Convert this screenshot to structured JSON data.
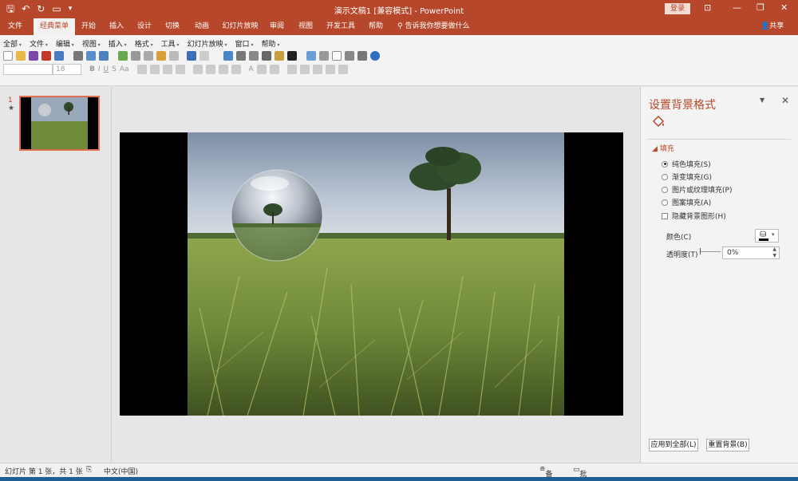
{
  "window": {
    "title": "演示文稿1 [兼容模式]  -  PowerPoint",
    "login_label": "登录"
  },
  "ribbon_tabs": [
    "文件",
    "经典菜单",
    "开始",
    "插入",
    "设计",
    "切换",
    "动画",
    "幻灯片放映",
    "审阅",
    "视图",
    "开发工具",
    "帮助"
  ],
  "active_tab": "经典菜单",
  "tell_me": "告诉我你想要做什么",
  "share": "共享",
  "classic_menu": [
    "全部",
    "文件",
    "编辑",
    "视图",
    "插入",
    "格式",
    "工具",
    "幻灯片放映",
    "窗口",
    "帮助"
  ],
  "font_size_value": "18",
  "slides": [
    {
      "number": "1",
      "marker": "★"
    }
  ],
  "format_pane": {
    "title": "设置背景格式",
    "section": "填充",
    "fill_options": [
      {
        "label": "纯色填充(S)",
        "selected": true
      },
      {
        "label": "渐变填充(G)",
        "selected": false
      },
      {
        "label": "图片或纹理填充(P)",
        "selected": false
      },
      {
        "label": "图案填充(A)",
        "selected": false
      }
    ],
    "hide_background": "隐藏背景图形(H)",
    "color_label": "颜色(C)",
    "transparency_label": "透明度(T)",
    "transparency_value": "0%",
    "apply_all": "应用到全部(L)",
    "reset_background": "重置背景(B)"
  },
  "statusbar": {
    "slide_info": "幻灯片 第 1 张，共 1 张",
    "language": "中文(中国)",
    "notes": "备注",
    "comments": "批注"
  },
  "colors": {
    "accent": "#b7472a",
    "sky_top": "#7d8fa6",
    "grass": "#6f8a3a"
  }
}
